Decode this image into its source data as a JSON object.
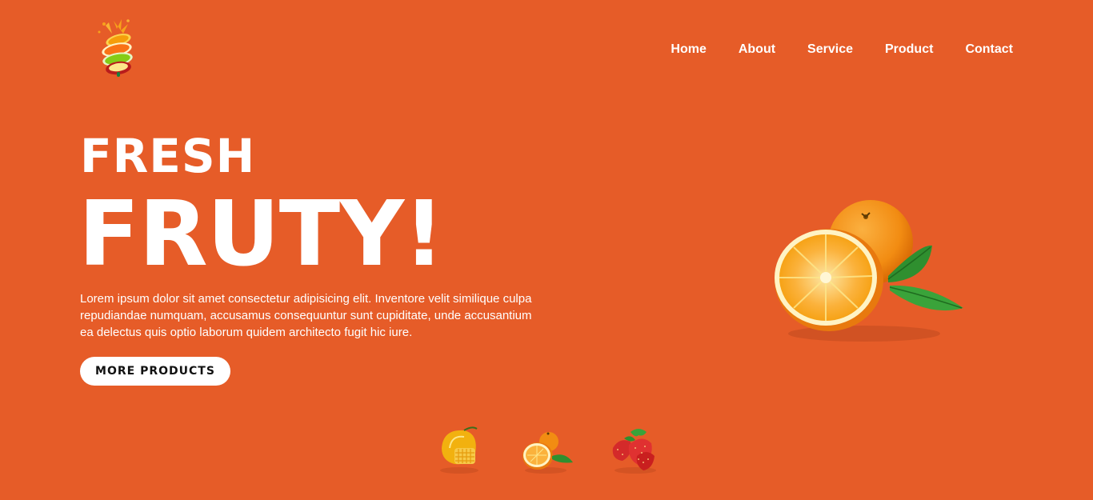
{
  "logo": {
    "icon": "fruit-splash-logo-icon"
  },
  "nav": {
    "items": [
      {
        "label": "Home"
      },
      {
        "label": "About"
      },
      {
        "label": "Service"
      },
      {
        "label": "Product"
      },
      {
        "label": "Contact"
      }
    ]
  },
  "hero": {
    "title_small": "FRESH",
    "title_large": "FRUTY!",
    "description": "Lorem ipsum dolor sit amet consectetur adipisicing elit. Inventore velit similique culpa repudiandae numquam, accusamus consequuntur sunt cupiditate, unde accusantium ea delectus quis optio laborum quidem architecto fugit hic iure.",
    "button_label": "MORE PRODUCTS",
    "image": "orange-with-leaves-image"
  },
  "thumbnails": [
    {
      "icon": "mango-icon"
    },
    {
      "icon": "orange-icon"
    },
    {
      "icon": "strawberry-icon"
    }
  ],
  "colors": {
    "background": "#e65c28",
    "text": "#ffffff",
    "button_bg": "#ffffff",
    "button_text": "#111111"
  }
}
